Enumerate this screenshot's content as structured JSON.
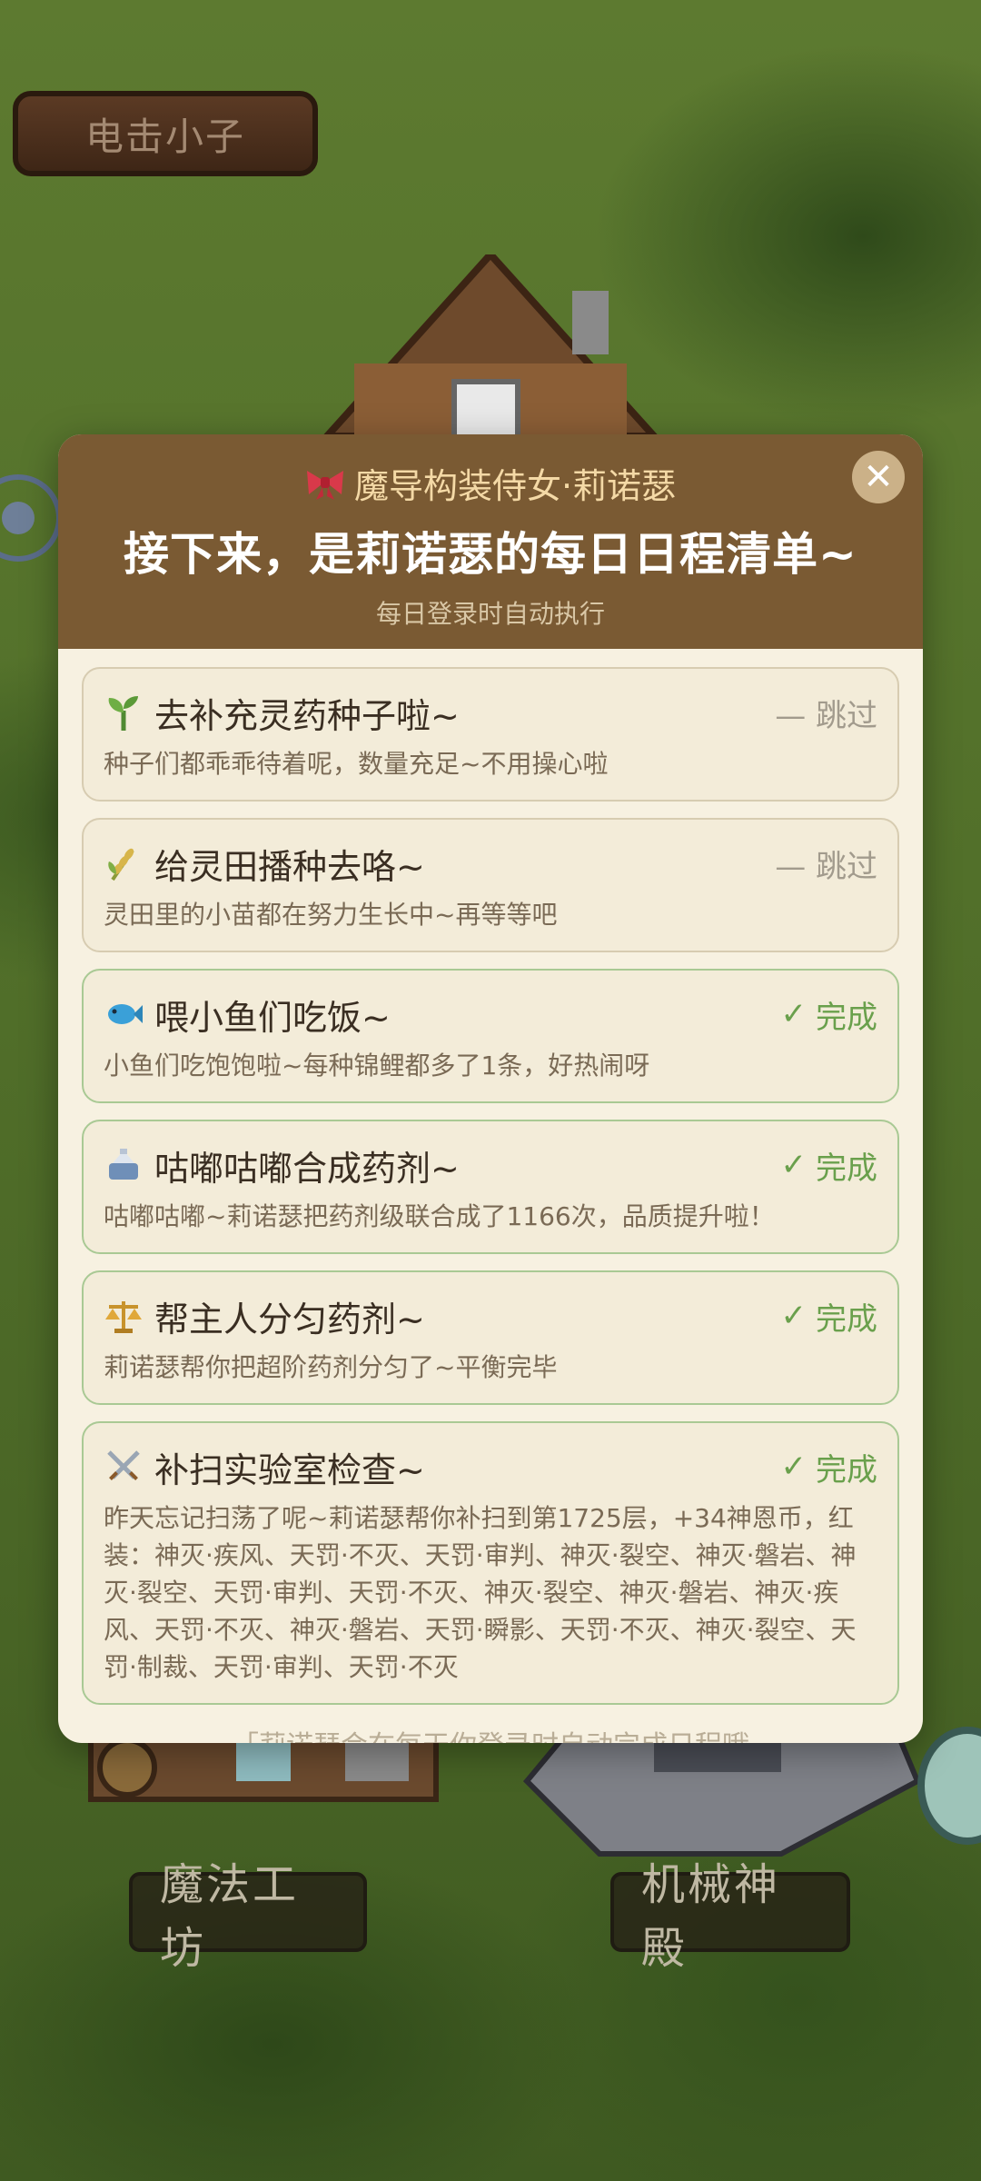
{
  "scene": {
    "sign_label": "电击小子",
    "zone_left": "魔法工坊",
    "zone_right": "机械神殿"
  },
  "modal": {
    "character": "魔导构装侍女·莉诺瑟",
    "title": "接下来，是莉诺瑟的每日日程清单~",
    "note": "每日登录时自动执行",
    "close_icon": "close-icon",
    "footer_hint": "「莉诺瑟会在每天你登录时自动完成日程哦"
  },
  "tasks": [
    {
      "icon": "sprout-icon",
      "title": "去补充灵药种子啦~",
      "status": "— 跳过",
      "state": "skip",
      "desc": "种子们都乖乖待着呢，数量充足~不用操心啦"
    },
    {
      "icon": "wheat-icon",
      "title": "给灵田播种去咯~",
      "status": "— 跳过",
      "state": "skip",
      "desc": "灵田里的小苗都在努力生长中~再等等吧"
    },
    {
      "icon": "fish-icon",
      "title": "喂小鱼们吃饭~",
      "status": "完成",
      "state": "done",
      "desc": "小鱼们吃饱饱啦~每种锦鲤都多了1条，好热闹呀"
    },
    {
      "icon": "alembic-icon",
      "title": "咕嘟咕嘟合成药剂~",
      "status": "完成",
      "state": "done",
      "desc": "咕嘟咕嘟~莉诺瑟把药剂级联合成了1166次，品质提升啦！"
    },
    {
      "icon": "scales-icon",
      "title": "帮主人分匀药剂~",
      "status": "完成",
      "state": "done",
      "desc": "莉诺瑟帮你把超阶药剂分匀了~平衡完毕"
    },
    {
      "icon": "crossed-swords-icon",
      "title": "补扫实验室检查~",
      "status": "完成",
      "state": "done",
      "desc": "昨天忘记扫荡了呢~莉诺瑟帮你补扫到第1725层，+34神恩币，红装：神灭·疾风、天罚·不灭、天罚·审判、神灭·裂空、神灭·磐岩、神灭·裂空、天罚·审判、天罚·不灭、神灭·裂空、神灭·磐岩、神灭·疾风、天罚·不灭、神灭·磐岩、天罚·瞬影、天罚·不灭、神灭·裂空、天罚·制裁、天罚·审判、天罚·不灭"
    }
  ]
}
